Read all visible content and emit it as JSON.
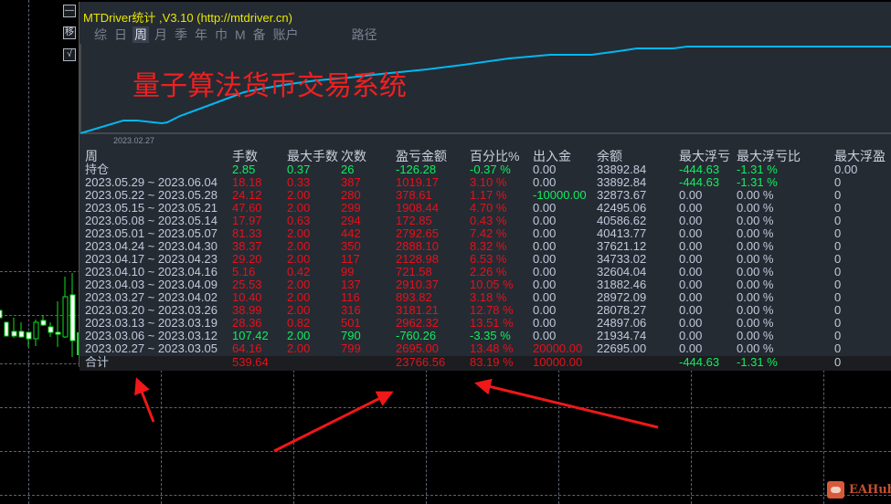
{
  "window": {
    "title": "MTDriver统计 ,V3.10 (http://mtdriver.cn)"
  },
  "tabs": [
    {
      "label": "综",
      "active": false
    },
    {
      "label": "日",
      "active": false
    },
    {
      "label": "周",
      "active": true
    },
    {
      "label": "月",
      "active": false
    },
    {
      "label": "季",
      "active": false
    },
    {
      "label": "年",
      "active": false
    },
    {
      "label": "巾",
      "active": false
    },
    {
      "label": "M",
      "active": false
    },
    {
      "label": "备",
      "active": false
    },
    {
      "label": "账户",
      "active": false
    }
  ],
  "path_label": "路径",
  "toolbar": {
    "minimize": "—",
    "move": "移",
    "check": "√"
  },
  "chart": {
    "start_date": "2023.02.27",
    "promo_text": "量子算法货币交易系统",
    "line_color": "#00b8f0"
  },
  "table": {
    "headers": [
      "周",
      "手数",
      "最大手数",
      "次数",
      "盈亏金额",
      "百分比%",
      "出入金",
      "余额",
      "最大浮亏",
      "最大浮亏比",
      "最大浮盈"
    ],
    "rows": [
      {
        "cells": [
          "持仓",
          "2.85",
          "0.37",
          "26",
          "-126.28",
          "-0.37 %",
          "0.00",
          "33892.84",
          "-444.63",
          "-1.31 %",
          "0.00"
        ],
        "colors": [
          "light",
          "green",
          "green",
          "green",
          "green",
          "green",
          "light",
          "light",
          "green",
          "green",
          "light"
        ]
      },
      {
        "cells": [
          "2023.05.29 ~ 2023.06.04",
          "18.18",
          "0.33",
          "387",
          "1019.17",
          "3.10 %",
          "0.00",
          "33892.84",
          "-444.63",
          "-1.31 %",
          "0"
        ],
        "colors": [
          "light",
          "red",
          "red",
          "red",
          "red",
          "red",
          "light",
          "light",
          "green",
          "green",
          "light"
        ]
      },
      {
        "cells": [
          "2023.05.22 ~ 2023.05.28",
          "24.12",
          "2.00",
          "280",
          "378.61",
          "1.17 %",
          "-10000.00",
          "32873.67",
          "0.00",
          "0.00 %",
          "0"
        ],
        "colors": [
          "light",
          "red",
          "red",
          "red",
          "red",
          "red",
          "green",
          "light",
          "light",
          "light",
          "light"
        ]
      },
      {
        "cells": [
          "2023.05.15 ~ 2023.05.21",
          "47.60",
          "2.00",
          "299",
          "1908.44",
          "4.70 %",
          "0.00",
          "42495.06",
          "0.00",
          "0.00 %",
          "0"
        ],
        "colors": [
          "light",
          "red",
          "red",
          "red",
          "red",
          "red",
          "light",
          "light",
          "light",
          "light",
          "light"
        ]
      },
      {
        "cells": [
          "2023.05.08 ~ 2023.05.14",
          "17.97",
          "0.63",
          "294",
          "172.85",
          "0.43 %",
          "0.00",
          "40586.62",
          "0.00",
          "0.00 %",
          "0"
        ],
        "colors": [
          "light",
          "red",
          "red",
          "red",
          "red",
          "red",
          "light",
          "light",
          "light",
          "light",
          "light"
        ]
      },
      {
        "cells": [
          "2023.05.01 ~ 2023.05.07",
          "81.33",
          "2.00",
          "442",
          "2792.65",
          "7.42 %",
          "0.00",
          "40413.77",
          "0.00",
          "0.00 %",
          "0"
        ],
        "colors": [
          "light",
          "red",
          "red",
          "red",
          "red",
          "red",
          "light",
          "light",
          "light",
          "light",
          "light"
        ]
      },
      {
        "cells": [
          "2023.04.24 ~ 2023.04.30",
          "38.37",
          "2.00",
          "350",
          "2888.10",
          "8.32 %",
          "0.00",
          "37621.12",
          "0.00",
          "0.00 %",
          "0"
        ],
        "colors": [
          "light",
          "red",
          "red",
          "red",
          "red",
          "red",
          "light",
          "light",
          "light",
          "light",
          "light"
        ]
      },
      {
        "cells": [
          "2023.04.17 ~ 2023.04.23",
          "29.20",
          "2.00",
          "117",
          "2128.98",
          "6.53 %",
          "0.00",
          "34733.02",
          "0.00",
          "0.00 %",
          "0"
        ],
        "colors": [
          "light",
          "red",
          "red",
          "red",
          "red",
          "red",
          "light",
          "light",
          "light",
          "light",
          "light"
        ]
      },
      {
        "cells": [
          "2023.04.10 ~ 2023.04.16",
          "5.16",
          "0.42",
          "99",
          "721.58",
          "2.26 %",
          "0.00",
          "32604.04",
          "0.00",
          "0.00 %",
          "0"
        ],
        "colors": [
          "light",
          "red",
          "red",
          "red",
          "red",
          "red",
          "light",
          "light",
          "light",
          "light",
          "light"
        ]
      },
      {
        "cells": [
          "2023.04.03 ~ 2023.04.09",
          "25.53",
          "2.00",
          "137",
          "2910.37",
          "10.05 %",
          "0.00",
          "31882.46",
          "0.00",
          "0.00 %",
          "0"
        ],
        "colors": [
          "light",
          "red",
          "red",
          "red",
          "red",
          "red",
          "light",
          "light",
          "light",
          "light",
          "light"
        ]
      },
      {
        "cells": [
          "2023.03.27 ~ 2023.04.02",
          "10.40",
          "2.00",
          "116",
          "893.82",
          "3.18 %",
          "0.00",
          "28972.09",
          "0.00",
          "0.00 %",
          "0"
        ],
        "colors": [
          "light",
          "red",
          "red",
          "red",
          "red",
          "red",
          "light",
          "light",
          "light",
          "light",
          "light"
        ]
      },
      {
        "cells": [
          "2023.03.20 ~ 2023.03.26",
          "38.99",
          "2.00",
          "316",
          "3181.21",
          "12.78 %",
          "0.00",
          "28078.27",
          "0.00",
          "0.00 %",
          "0"
        ],
        "colors": [
          "light",
          "red",
          "red",
          "red",
          "red",
          "red",
          "light",
          "light",
          "light",
          "light",
          "light"
        ]
      },
      {
        "cells": [
          "2023.03.13 ~ 2023.03.19",
          "28.36",
          "0.82",
          "501",
          "2962.32",
          "13.51 %",
          "0.00",
          "24897.06",
          "0.00",
          "0.00 %",
          "0"
        ],
        "colors": [
          "light",
          "red",
          "red",
          "red",
          "red",
          "red",
          "light",
          "light",
          "light",
          "light",
          "light"
        ]
      },
      {
        "cells": [
          "2023.03.06 ~ 2023.03.12",
          "107.42",
          "2.00",
          "790",
          "-760.26",
          "-3.35 %",
          "0.00",
          "21934.74",
          "0.00",
          "0.00 %",
          "0"
        ],
        "colors": [
          "light",
          "green",
          "green",
          "green",
          "green",
          "green",
          "light",
          "light",
          "light",
          "light",
          "light"
        ]
      },
      {
        "cells": [
          "2023.02.27 ~ 2023.03.05",
          "64.16",
          "2.00",
          "799",
          "2695.00",
          "13.48 %",
          "20000.00",
          "22695.00",
          "0.00",
          "0.00 %",
          "0"
        ],
        "colors": [
          "light",
          "red",
          "red",
          "red",
          "red",
          "red",
          "red",
          "light",
          "light",
          "light",
          "light"
        ]
      }
    ],
    "total": {
      "cells": [
        "合计",
        "539.64",
        "",
        "",
        "23766.56",
        "83.19 %",
        "10000.00",
        "",
        "-444.63",
        "-1.31 %",
        "0"
      ],
      "colors": [
        "light",
        "red",
        "red",
        "red",
        "red",
        "red",
        "red",
        "light",
        "green",
        "green",
        "light"
      ]
    }
  },
  "watermark": "EAHub"
}
